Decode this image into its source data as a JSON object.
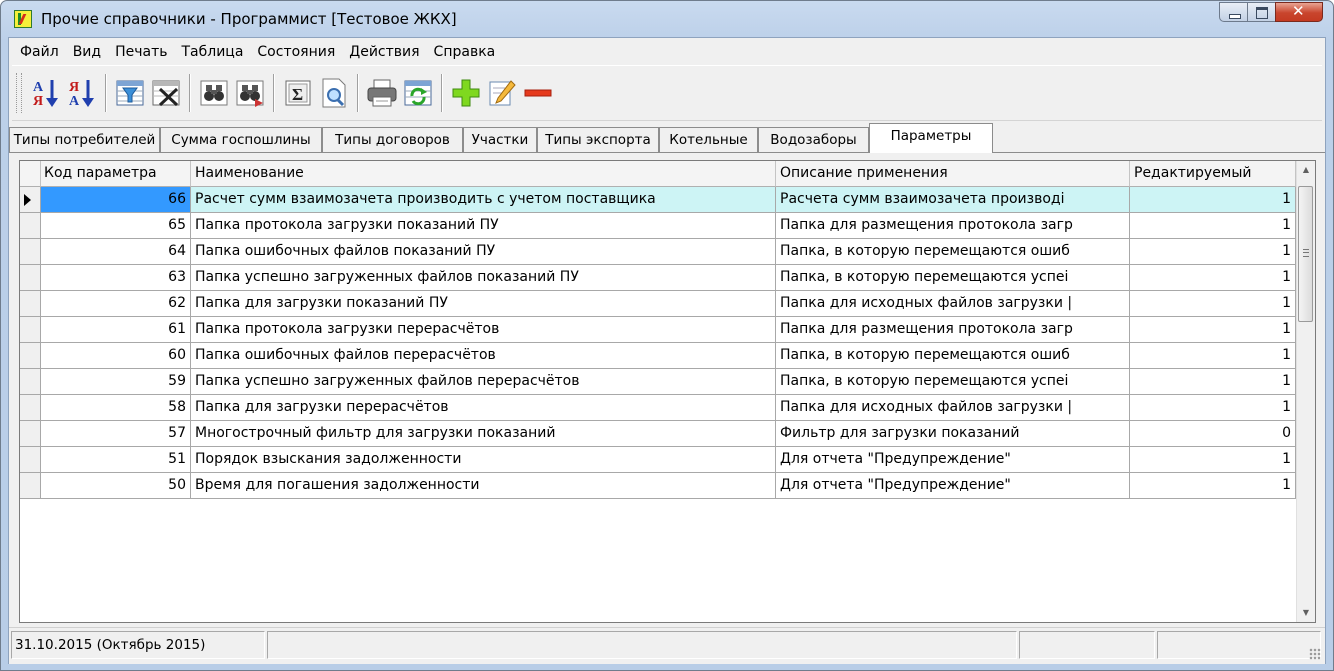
{
  "window": {
    "title": "Прочие справочники - Программист   [Тестовое ЖКХ]"
  },
  "menu": [
    "Файл",
    "Вид",
    "Печать",
    "Таблица",
    "Состояния",
    "Действия",
    "Справка"
  ],
  "toolbar_icons": [
    "sort-ascending-icon",
    "sort-descending-icon",
    "filter-icon",
    "clear-filter-icon",
    "find-icon",
    "find-next-icon",
    "sum-icon",
    "preview-icon",
    "print-icon",
    "refresh-icon",
    "add-icon",
    "edit-icon",
    "delete-icon"
  ],
  "tabs": [
    "Типы потребителей",
    "Сумма госпошлины",
    "Типы договоров",
    "Участки",
    "Типы экспорта",
    "Котельные",
    "Водозаборы",
    "Параметры"
  ],
  "active_tab": "Параметры",
  "grid": {
    "columns": [
      "Код параметра",
      "Наименование",
      "Описание применения",
      "Редактируемый"
    ],
    "rows": [
      {
        "code": "66",
        "name": "Расчет сумм взаимозачета производить с учетом поставщика",
        "desc": "Расчета сумм взаимозачета производі",
        "edit": "1"
      },
      {
        "code": "65",
        "name": "Папка протокола загрузки показаний ПУ",
        "desc": "Папка для размещения протокола загр",
        "edit": "1"
      },
      {
        "code": "64",
        "name": "Папка ошибочных файлов показаний ПУ",
        "desc": "Папка, в которую перемещаются ошиб",
        "edit": "1"
      },
      {
        "code": "63",
        "name": "Папка успешно загруженных файлов показаний ПУ",
        "desc": "Папка, в которую перемещаются успеі",
        "edit": "1"
      },
      {
        "code": "62",
        "name": "Папка для загрузки показаний ПУ",
        "desc": "Папка для исходных файлов загрузки |",
        "edit": "1"
      },
      {
        "code": "61",
        "name": "Папка протокола загрузки перерасчётов",
        "desc": "Папка для размещения протокола загр",
        "edit": "1"
      },
      {
        "code": "60",
        "name": "Папка ошибочных файлов перерасчётов",
        "desc": "Папка, в которую перемещаются ошиб",
        "edit": "1"
      },
      {
        "code": "59",
        "name": "Папка успешно загруженных файлов перерасчётов",
        "desc": "Папка, в которую перемещаются успеі",
        "edit": "1"
      },
      {
        "code": "58",
        "name": "Папка для загрузки перерасчётов",
        "desc": "Папка для исходных файлов загрузки |",
        "edit": "1"
      },
      {
        "code": "57",
        "name": "Многострочный фильтр для загрузки показаний",
        "desc": "Фильтр для загрузки показаний",
        "edit": "0"
      },
      {
        "code": "51",
        "name": "Порядок взыскания задолженности",
        "desc": "Для отчета \"Предупреждение\"",
        "edit": "1"
      },
      {
        "code": "50",
        "name": "Время для погашения задолженности",
        "desc": "Для отчета \"Предупреждение\"",
        "edit": "1"
      }
    ]
  },
  "status": {
    "date": "31.10.2015 (Октябрь 2015)"
  },
  "colors": {
    "selected_row": "#cdf4f5",
    "focus_cell": "#3399ff",
    "close_button": "#c9452d"
  }
}
